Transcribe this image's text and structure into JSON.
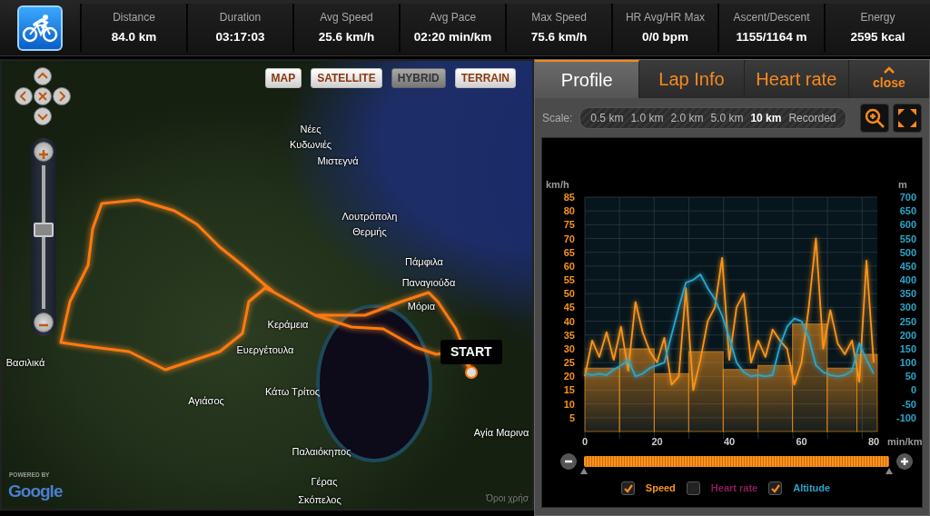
{
  "stats": [
    {
      "label": "Distance",
      "value": "84.0 km"
    },
    {
      "label": "Duration",
      "value": "03:17:03"
    },
    {
      "label": "Avg Speed",
      "value": "25.6 km/h"
    },
    {
      "label": "Avg Pace",
      "value": "02:20 min/km"
    },
    {
      "label": "Max Speed",
      "value": "75.6 km/h"
    },
    {
      "label": "HR Avg/HR Max",
      "value": "0/0 bpm"
    },
    {
      "label": "Ascent/Descent",
      "value": "1155/1164 m"
    },
    {
      "label": "Energy",
      "value": "2595 kcal"
    }
  ],
  "map": {
    "type_buttons": [
      {
        "label": "MAP",
        "selected": false
      },
      {
        "label": "SATELLITE",
        "selected": false
      },
      {
        "label": "HYBRID",
        "selected": true
      },
      {
        "label": "TERRAIN",
        "selected": false
      }
    ],
    "zoom": {
      "level": 0.55
    },
    "places": [
      "Νέες Κυδωνιές",
      "Μιστεγνά",
      "Λουτρόπολη Θερμής",
      "Πάμφιλα",
      "Παναγιούδα",
      "Μόρια",
      "Κεράμεια",
      "Ευεργέτουλα",
      "Βασιλικά",
      "Αγιάσος",
      "Κάτω Τρίτος",
      "Αγία Μαρινα",
      "Παλαιόκηπος",
      "Γέρας",
      "Σκόπελος"
    ],
    "start_label": "START",
    "powered_by": "POWERED BY",
    "logo": "Google",
    "terms": "Όροι χρήσ"
  },
  "panel": {
    "tabs": [
      {
        "label": "Profile",
        "selected": true
      },
      {
        "label": "Lap Info",
        "selected": false
      },
      {
        "label": "Heart rate",
        "selected": false
      }
    ],
    "close_label": "close",
    "scale": {
      "label": "Scale:",
      "options": [
        {
          "label": "0.5 km",
          "selected": false
        },
        {
          "label": "1.0 km",
          "selected": false
        },
        {
          "label": "2.0 km",
          "selected": false
        },
        {
          "label": "5.0 km",
          "selected": false
        },
        {
          "label": "10 km",
          "selected": true
        },
        {
          "label": "Recorded",
          "selected": false
        }
      ]
    },
    "chart_data": {
      "type": "line",
      "xlabel": "min/km",
      "ylabel": "km/h",
      "y2label": "m",
      "x": [
        0,
        2,
        4,
        6,
        8,
        10,
        12,
        14,
        16,
        18,
        20,
        22,
        24,
        26,
        28,
        30,
        32,
        34,
        36,
        38,
        40,
        42,
        44,
        46,
        48,
        50,
        52,
        54,
        56,
        58,
        60,
        62,
        64,
        66,
        68,
        70,
        72,
        74,
        76,
        78,
        80
      ],
      "series": [
        {
          "name": "Speed",
          "color": "#f7941d",
          "values": [
            20,
            33,
            27,
            36,
            26,
            38,
            22,
            47,
            36,
            29,
            25,
            34,
            17,
            20,
            52,
            15,
            26,
            40,
            45,
            63,
            26,
            45,
            50,
            25,
            33,
            27,
            37,
            33,
            30,
            17,
            25,
            45,
            70,
            30,
            44,
            32,
            28,
            33,
            18,
            62,
            25
          ]
        },
        {
          "name": "Heart rate",
          "color": "#8b1e5a",
          "values": [
            null,
            null,
            null,
            null,
            null,
            null,
            null,
            null,
            null,
            null,
            null,
            null,
            null,
            null,
            null,
            null,
            null,
            null,
            null,
            null,
            null,
            null,
            null,
            null,
            null,
            null,
            null,
            null,
            null,
            null,
            null,
            null,
            null,
            null,
            null,
            null,
            null,
            null,
            null,
            null,
            null
          ]
        },
        {
          "name": "Altitude",
          "color": "#2ba6cb",
          "axis": "y2",
          "values": [
            60,
            55,
            60,
            55,
            75,
            90,
            110,
            50,
            60,
            80,
            90,
            100,
            200,
            300,
            390,
            400,
            420,
            370,
            330,
            270,
            190,
            100,
            65,
            50,
            55,
            50,
            55,
            160,
            230,
            260,
            250,
            190,
            90,
            65,
            55,
            50,
            55,
            70,
            170,
            110,
            60
          ]
        },
        {
          "type": "bar",
          "color": "#f7941d",
          "x": [
            4.8,
            14.4,
            24,
            33.5,
            43.1,
            52.7,
            62.3,
            71.9,
            78.8
          ],
          "values": [
            23,
            30,
            21,
            29,
            22.5,
            24,
            39,
            23,
            28
          ]
        }
      ],
      "xlim": [
        0,
        81
      ],
      "grid": true,
      "ylim": [
        0,
        85
      ],
      "y2lim": [
        -150,
        700
      ],
      "xticks": [
        0,
        20,
        40,
        60,
        80
      ],
      "yticks": [
        5,
        10,
        15,
        20,
        25,
        30,
        35,
        40,
        45,
        50,
        55,
        60,
        65,
        70,
        75,
        80,
        85
      ],
      "y2ticks": [
        -100,
        -50,
        0,
        50,
        100,
        150,
        200,
        250,
        300,
        350,
        400,
        450,
        500,
        550,
        600,
        650,
        700
      ]
    },
    "range": {
      "level": 1
    },
    "legend": [
      {
        "checked": true
      },
      {
        "checked": false
      },
      {
        "checked": true
      }
    ]
  }
}
